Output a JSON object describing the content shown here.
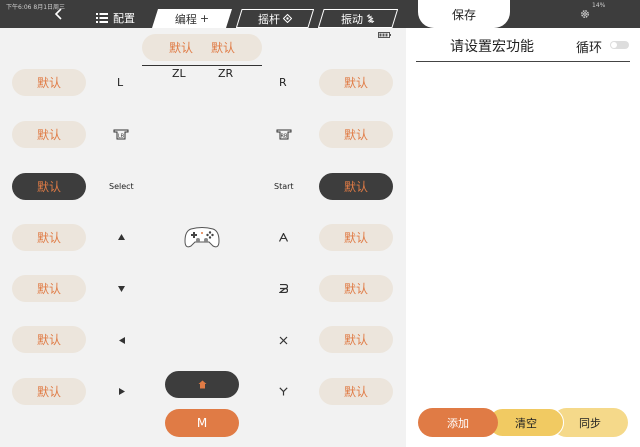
{
  "status_bar": {
    "left_text": "下午6:06  8月1日周三",
    "right_text": "14%"
  },
  "tabs": {
    "config": "配置",
    "program": "编程",
    "program_suffix": "+",
    "stick": "摇杆",
    "vibrate": "振动"
  },
  "default_label": "默认",
  "triggers": {
    "zl": "ZL",
    "zr": "ZR",
    "top_left_value": "默认",
    "top_right_value": "默认"
  },
  "left_column": [
    "默认",
    "默认",
    "默认",
    "默认",
    "默认",
    "默认",
    "默认"
  ],
  "right_column": [
    "默认",
    "默认",
    "默认",
    "默认",
    "默认",
    "默认",
    "默认"
  ],
  "labels": {
    "l": "L",
    "r": "R",
    "select": "Select",
    "start": "Start",
    "m": "M"
  },
  "icons": {
    "back": "chevron-left-icon",
    "config": "list-icon",
    "battery": "battery-icon",
    "lb": "left-back-button-icon",
    "rb": "right-back-button-icon",
    "gamepad": "gamepad-icon",
    "dpad_up": "dpad-up-icon",
    "dpad_down": "dpad-down-icon",
    "dpad_left": "dpad-left-icon",
    "dpad_right": "dpad-right-icon",
    "face_a": "face-a-icon",
    "face_b": "face-b-icon",
    "face_x": "face-x-icon",
    "face_y": "face-y-icon",
    "home": "home-icon",
    "settings": "gear-icon"
  },
  "macro_panel": {
    "save": "保存",
    "title": "请设置宏功能",
    "loop": "循环",
    "loop_on": false,
    "add": "添加",
    "clear": "清空",
    "sync": "同步"
  },
  "colors": {
    "accent": "#e07b45",
    "dark": "#3d3d3d",
    "pill_bg": "#ece5dc",
    "panel_bg": "#f2f2f2",
    "yellow": "#f1ca62",
    "light_yellow": "#f5d98a"
  }
}
